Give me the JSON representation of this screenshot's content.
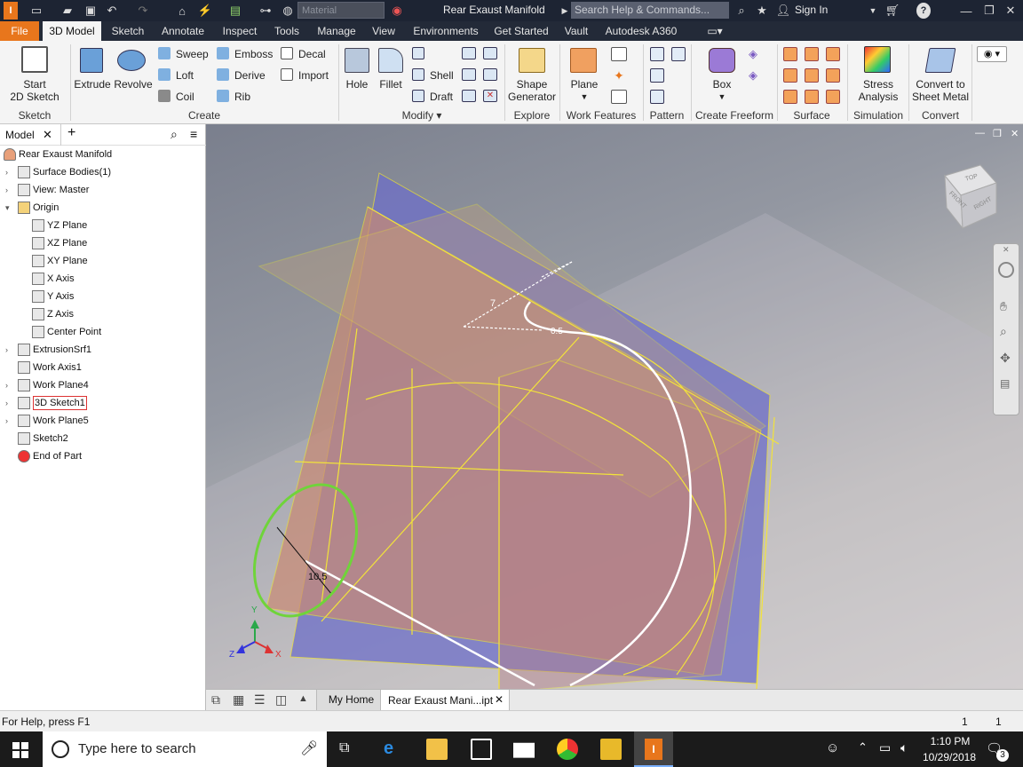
{
  "title_bar": {
    "material_placeholder": "Material",
    "document_title": "Rear Exaust Manifold",
    "search_placeholder": "Search Help & Commands...",
    "sign_in": "Sign In",
    "help": "?"
  },
  "menu": {
    "tabs": [
      "File",
      "3D Model",
      "Sketch",
      "Annotate",
      "Inspect",
      "Tools",
      "Manage",
      "View",
      "Environments",
      "Get Started",
      "Vault",
      "Autodesk A360"
    ],
    "active": "3D Model"
  },
  "ribbon": {
    "sketch": {
      "start_line1": "Start",
      "start_line2": "2D Sketch",
      "group": "Sketch"
    },
    "create": {
      "extrude": "Extrude",
      "revolve": "Revolve",
      "sweep": "Sweep",
      "loft": "Loft",
      "coil": "Coil",
      "emboss": "Emboss",
      "derive": "Derive",
      "rib": "Rib",
      "decal": "Decal",
      "import": "Import",
      "group": "Create"
    },
    "modify": {
      "hole": "Hole",
      "fillet": "Fillet",
      "shell": "Shell",
      "draft": "Draft",
      "group": "Modify"
    },
    "explore": {
      "shape_line1": "Shape",
      "shape_line2": "Generator",
      "group": "Explore"
    },
    "work_features": {
      "plane": "Plane",
      "group": "Work Features"
    },
    "pattern": {
      "group": "Pattern"
    },
    "freeform": {
      "box": "Box",
      "group": "Create Freeform"
    },
    "surface": {
      "group": "Surface"
    },
    "simulation": {
      "stress_line1": "Stress",
      "stress_line2": "Analysis",
      "group": "Simulation"
    },
    "convert": {
      "line1": "Convert to",
      "line2": "Sheet Metal",
      "group": "Convert"
    }
  },
  "browser": {
    "tab": "Model",
    "tree": [
      {
        "label": "Rear Exaust Manifold",
        "level": 0,
        "expander": ""
      },
      {
        "label": "Surface Bodies(1)",
        "level": 1,
        "expander": "right"
      },
      {
        "label": "View: Master",
        "level": 1,
        "expander": "right"
      },
      {
        "label": "Origin",
        "level": 1,
        "expander": "down"
      },
      {
        "label": "YZ Plane",
        "level": 2,
        "expander": ""
      },
      {
        "label": "XZ Plane",
        "level": 2,
        "expander": ""
      },
      {
        "label": "XY Plane",
        "level": 2,
        "expander": ""
      },
      {
        "label": "X Axis",
        "level": 2,
        "expander": ""
      },
      {
        "label": "Y Axis",
        "level": 2,
        "expander": ""
      },
      {
        "label": "Z Axis",
        "level": 2,
        "expander": ""
      },
      {
        "label": "Center Point",
        "level": 2,
        "expander": ""
      },
      {
        "label": "ExtrusionSrf1",
        "level": 1,
        "expander": "right"
      },
      {
        "label": "Work Axis1",
        "level": 1,
        "expander": ""
      },
      {
        "label": "Work Plane4",
        "level": 1,
        "expander": "right"
      },
      {
        "label": "3D Sketch1",
        "level": 1,
        "expander": "right"
      },
      {
        "label": "Work Plane5",
        "level": 1,
        "expander": "right"
      },
      {
        "label": "Sketch2",
        "level": 1,
        "expander": ""
      },
      {
        "label": "End of Part",
        "level": 1,
        "expander": ""
      }
    ]
  },
  "viewport": {
    "dimension_1": "7",
    "dimension_2": "0.5",
    "dimension_3": "10.5",
    "axis_x": "X",
    "axis_y": "Y",
    "axis_z": "Z",
    "viewcube_top": "TOP",
    "viewcube_front": "FRONT",
    "viewcube_right": "RIGHT"
  },
  "doc_tabs": {
    "home": "My Home",
    "active": "Rear Exaust Mani...ipt"
  },
  "status": {
    "help": "For Help, press F1",
    "count1": "1",
    "count2": "1"
  },
  "taskbar": {
    "search_placeholder": "Type here to search",
    "time": "1:10 PM",
    "date": "10/29/2018",
    "notifications": "3"
  },
  "colors": {
    "accent_orange": "#e8761c",
    "sketch_yellow": "#f2e33a",
    "profile_green": "#6fd43a",
    "title_bg": "#1d2433"
  }
}
